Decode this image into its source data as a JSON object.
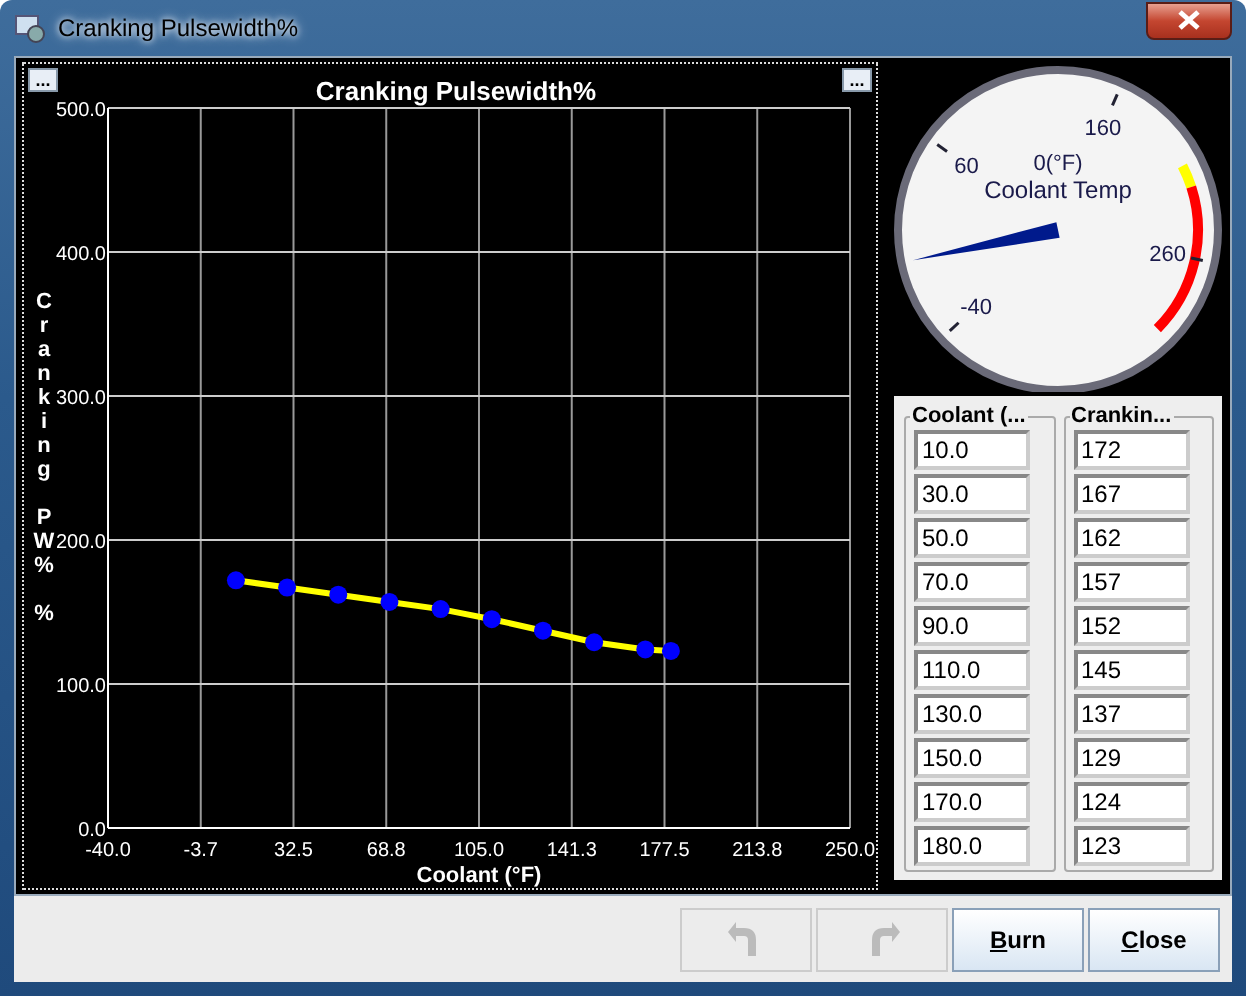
{
  "window": {
    "title": "Cranking Pulsewidth%"
  },
  "chart": {
    "corner_buttons": [
      "...",
      "..."
    ],
    "chart_data": {
      "type": "line",
      "title": "Cranking Pulsewidth%",
      "xlabel": "Coolant (°F)",
      "ylabel": "Cranking PW% %",
      "x": [
        10,
        30,
        50,
        70,
        90,
        110,
        130,
        150,
        170,
        180
      ],
      "grid": true,
      "series": [
        {
          "color": "#ffff00",
          "marker": "circle",
          "values": [
            172,
            167,
            162,
            157,
            152,
            145,
            137,
            129,
            124,
            123
          ]
        }
      ],
      "xlim": [
        -40,
        250
      ],
      "ylim": [
        0,
        500
      ],
      "xticks": [
        {
          "value": -40,
          "label": "-40.0"
        },
        {
          "value": -3.75,
          "label": "-3.7"
        },
        {
          "value": 32.5,
          "label": "32.5"
        },
        {
          "value": 68.75,
          "label": "68.8"
        },
        {
          "value": 105,
          "label": "105.0"
        },
        {
          "value": 141.25,
          "label": "141.3"
        },
        {
          "value": 177.5,
          "label": "177.5"
        },
        {
          "value": 213.75,
          "label": "213.8"
        },
        {
          "value": 250,
          "label": "250.0"
        }
      ],
      "yticks": [
        {
          "value": 0,
          "label": "0.0"
        },
        {
          "value": 100,
          "label": "100.0"
        },
        {
          "value": 200,
          "label": "200.0"
        },
        {
          "value": 300,
          "label": "300.0"
        },
        {
          "value": 400,
          "label": "400.0"
        },
        {
          "value": 500,
          "label": "500.0"
        }
      ]
    }
  },
  "gauge": {
    "title": "Coolant Temp",
    "reading": "0(°F)",
    "level": 0.133,
    "tick_labels": [
      "-40",
      "60",
      "160",
      "260"
    ]
  },
  "table": {
    "columns": [
      "Coolant (...",
      "Crankin..."
    ],
    "rows": [
      [
        "10.0",
        "172"
      ],
      [
        "30.0",
        "167"
      ],
      [
        "50.0",
        "162"
      ],
      [
        "70.0",
        "157"
      ],
      [
        "90.0",
        "152"
      ],
      [
        "110.0",
        "145"
      ],
      [
        "130.0",
        "137"
      ],
      [
        "150.0",
        "129"
      ],
      [
        "170.0",
        "124"
      ],
      [
        "180.0",
        "123"
      ]
    ]
  },
  "buttons": [
    {
      "kind": "undo",
      "disabled": true
    },
    {
      "kind": "redo",
      "disabled": true
    },
    {
      "kind": "text",
      "label": "Burn",
      "disabled": false
    },
    {
      "kind": "text",
      "label": "Close",
      "disabled": false
    }
  ]
}
